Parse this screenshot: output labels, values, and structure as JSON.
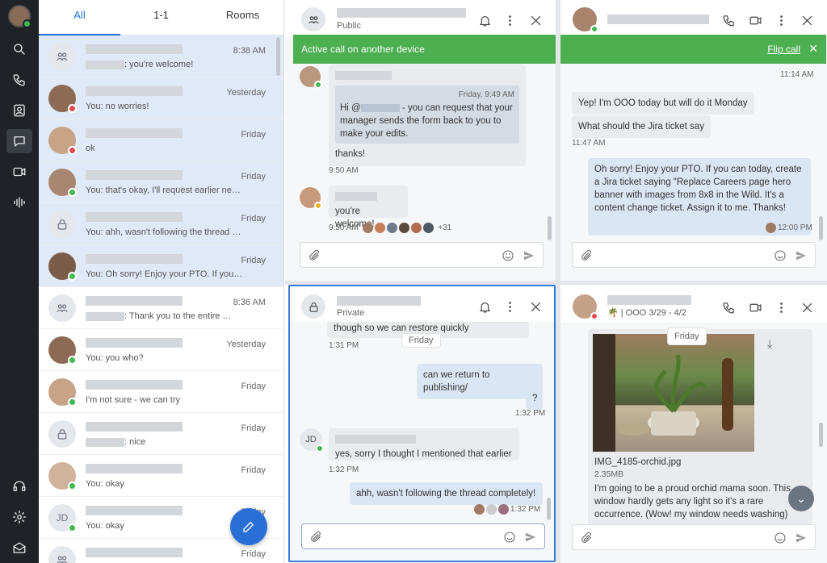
{
  "tabs": [
    "All",
    "1-1",
    "Rooms"
  ],
  "conversations": [
    {
      "preview": ": you're welcome!",
      "time": "8:38 AM",
      "avatar": "room",
      "status": "",
      "selected": true
    },
    {
      "preview": "You: no worries!",
      "time": "Yesterday",
      "avatar": "photo",
      "status": "r",
      "selected": true
    },
    {
      "preview": "ok",
      "time": "Friday",
      "avatar": "photo",
      "status": "r",
      "selected": true
    },
    {
      "preview": "You: that's okay, I'll request earlier next …",
      "time": "Friday",
      "avatar": "photo",
      "status": "g",
      "selected": true
    },
    {
      "preview": "You: ahh, wasn't following the thread c...",
      "time": "Friday",
      "avatar": "lock",
      "status": "",
      "selected": true
    },
    {
      "preview": "You: Oh sorry! Enjoy your PTO. If you ca...",
      "time": "Friday",
      "avatar": "photo",
      "status": "g",
      "selected": true
    },
    {
      "preview": ": Thank you to the entire …",
      "time": "8:36 AM",
      "avatar": "room",
      "status": "",
      "selected": false
    },
    {
      "preview": "You: you who?",
      "time": "Yesterday",
      "avatar": "photo",
      "status": "g",
      "selected": false
    },
    {
      "preview": "I'm not sure - we can try",
      "time": "Friday",
      "avatar": "photo",
      "status": "g",
      "selected": false
    },
    {
      "preview": ": nice",
      "time": "Friday",
      "avatar": "lock",
      "status": "",
      "selected": false
    },
    {
      "preview": "You: okay",
      "time": "Friday",
      "avatar": "photo",
      "status": "g",
      "selected": false
    },
    {
      "preview": "You: okay",
      "time": "Friday",
      "avatar": "JD",
      "status": "g",
      "selected": false
    },
    {
      "preview": "",
      "time": "Friday",
      "avatar": "room",
      "status": "",
      "selected": false
    }
  ],
  "pane1": {
    "subtitle": "Public",
    "quote_time": "Friday, 9:49 AM",
    "quote_text_pre": "Hi @",
    "quote_text_post": " - you can request that your manager sends the form back to you to make your edits.",
    "msg1": "thanks!",
    "time1": "9:50 AM",
    "msg2": "you're welcome!",
    "time2": "9:50 AM",
    "reactions_more": "+31"
  },
  "pane2": {
    "banner_text": "Active call on another device",
    "banner_action": "Flip call",
    "time_top": "11:14 AM",
    "msg1": "Yep! I'm OOO today but will do it Monday",
    "msg2": "What should the Jira ticket say",
    "time2": "11:47 AM",
    "msg3": "Oh sorry! Enjoy your PTO. If you can today, create a Jira ticket saying \"Replace Careers page hero banner with images from 8x8 in the Wild. It's a content change ticket. Assign it to me. Thanks!",
    "time3": "12:00 PM"
  },
  "pane3": {
    "subtitle": "Private",
    "cut_text": "though so we can restore quickly",
    "time0": "1:31 PM",
    "date": "Friday",
    "msg1": "can we return to publishing/",
    "msg2": "?",
    "time2": "1:32 PM",
    "jd": "JD",
    "msg3": "yes, sorry I thought I mentioned that earlier",
    "time3": "1:32 PM",
    "msg4": "ahh, wasn't following the thread completely!",
    "time4": "1:32 PM"
  },
  "pane4": {
    "status": "| OOO 3/29 - 4/2",
    "date": "Friday",
    "file_name": "IMG_4185-orchid.jpg",
    "file_size": "2.35MB",
    "msg": "I'm going to be a proud orchid mama soon. This window hardly gets any light so it's a rare occurrence. (Wow! my window needs washing)"
  },
  "colors": {
    "accent": "#2a6fd6",
    "banner": "#4caf50",
    "online": "#3fb950",
    "busy": "#e5484d"
  }
}
